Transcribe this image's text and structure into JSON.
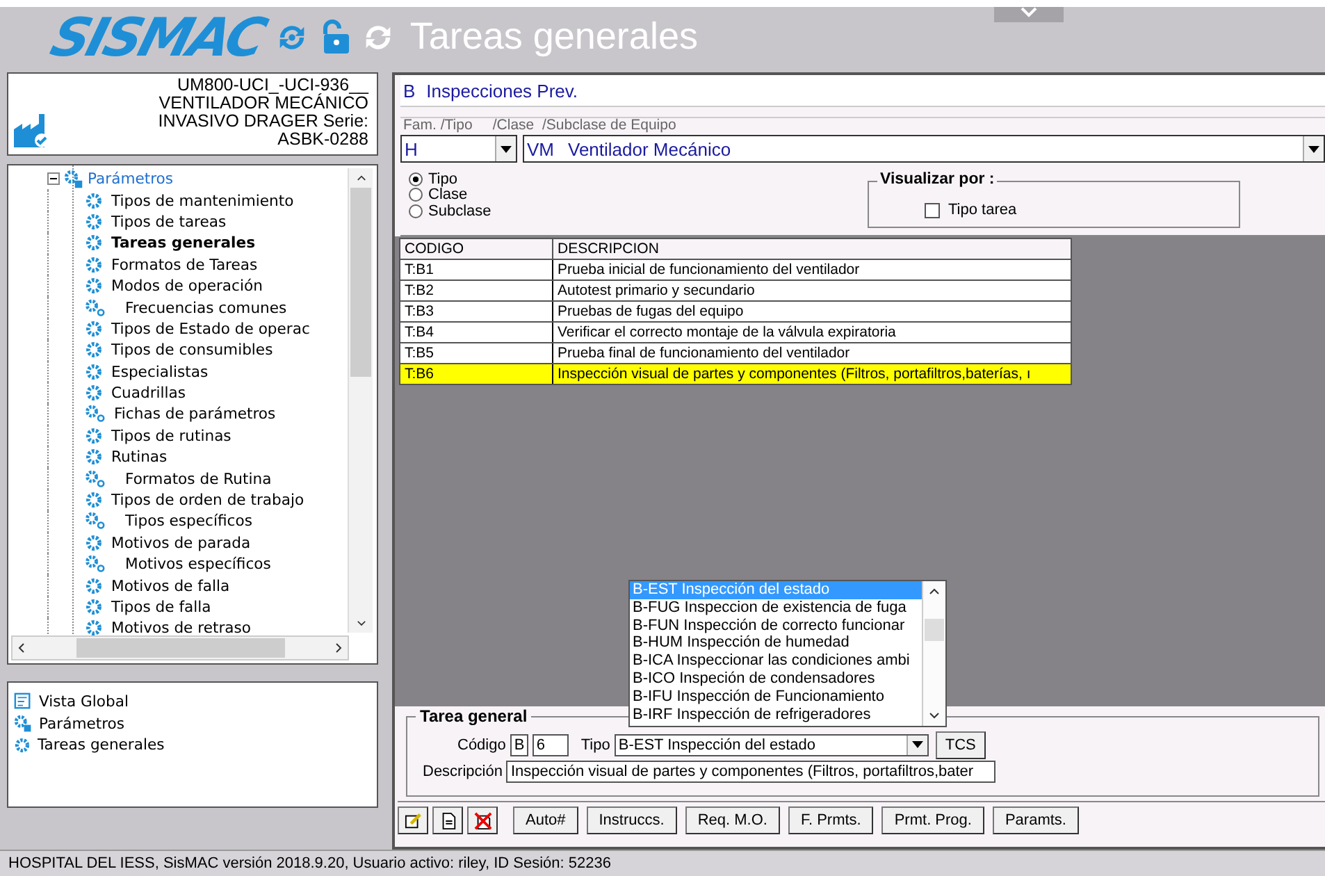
{
  "header": {
    "logo": "SISMAC",
    "title": "Tareas generales"
  },
  "equipment": {
    "lines": [
      "UM800-UCI_-UCI-936__",
      "VENTILADOR MECÁNICO",
      "INVASIVO DRAGER Serie:",
      "ASBK-0288"
    ]
  },
  "tree": {
    "root": {
      "label": "Parámetros",
      "expanded": true,
      "children": [
        {
          "label": "Tipos de mantenimiento",
          "kind": "item",
          "selected": false
        },
        {
          "label": "Tipos de tareas",
          "kind": "item",
          "selected": false
        },
        {
          "label": "Tareas generales",
          "kind": "item",
          "selected": true
        },
        {
          "label": "Formatos de Tareas",
          "kind": "item",
          "selected": false
        },
        {
          "label": "Modos de operación",
          "kind": "item",
          "selected": false
        },
        {
          "label": "Frecuencias comunes",
          "kind": "subgroup",
          "selected": false
        },
        {
          "label": "Tipos de Estado de operac",
          "kind": "item",
          "selected": false
        },
        {
          "label": "Tipos de consumibles",
          "kind": "item",
          "selected": false
        },
        {
          "label": "Especialistas",
          "kind": "item",
          "selected": false
        },
        {
          "label": "Cuadrillas",
          "kind": "item",
          "selected": false
        },
        {
          "label": "Fichas de parámetros",
          "kind": "group",
          "selected": false
        },
        {
          "label": "Tipos de rutinas",
          "kind": "item",
          "selected": false
        },
        {
          "label": "Rutinas",
          "kind": "item",
          "selected": false
        },
        {
          "label": "Formatos de Rutina",
          "kind": "subgroup",
          "selected": false
        },
        {
          "label": "Tipos de orden de trabajo",
          "kind": "item",
          "selected": false
        },
        {
          "label": "Tipos específicos",
          "kind": "subgroup",
          "selected": false
        },
        {
          "label": "Motivos de parada",
          "kind": "item",
          "selected": false
        },
        {
          "label": "Motivos específicos",
          "kind": "subgroup",
          "selected": false
        },
        {
          "label": "Motivos de falla",
          "kind": "item",
          "selected": false
        },
        {
          "label": "Tipos de falla",
          "kind": "item",
          "selected": false
        },
        {
          "label": "Motivos de retraso",
          "kind": "item",
          "selected": false
        }
      ]
    }
  },
  "breadcrumb": [
    {
      "label": "Vista Global",
      "kind": "global"
    },
    {
      "label": "Parámetros",
      "kind": "group"
    },
    {
      "label": "Tareas generales",
      "kind": "item"
    }
  ],
  "category": {
    "code": "B",
    "name": "Inspecciones Prev."
  },
  "equipment_filter": {
    "legend": "Fam. /Tipo     /Clase  /Subclase de Equipo",
    "family": "H",
    "type_code": "VM",
    "type_name": "Ventilador Mecánico"
  },
  "view_by": [
    {
      "label": "Tipo",
      "selected": true
    },
    {
      "label": "Clase",
      "selected": false
    },
    {
      "label": "Subclase",
      "selected": false
    }
  ],
  "visualizar": {
    "title": "Visualizar por :",
    "checkbox": {
      "label": "Tipo tarea",
      "checked": false
    }
  },
  "table": {
    "columns": [
      "CODIGO",
      "DESCRIPCION"
    ],
    "rows": [
      {
        "code": "T:B1",
        "description": "Prueba inicial de funcionamiento del ventilador",
        "selected": false
      },
      {
        "code": "T:B2",
        "description": "Autotest primario y secundario",
        "selected": false
      },
      {
        "code": "T:B3",
        "description": "Pruebas de fugas del equipo",
        "selected": false
      },
      {
        "code": "T:B4",
        "description": "Verificar el correcto montaje de la válvula expiratoria",
        "selected": false
      },
      {
        "code": "T:B5",
        "description": "Prueba final de funcionamiento del ventilador",
        "selected": false
      },
      {
        "code": "T:B6",
        "description": "Inspección visual de partes y componentes (Filtros, portafiltros,baterías, ı",
        "selected": true
      }
    ]
  },
  "dropdown": {
    "options": [
      {
        "label": "B-EST Inspección del estado",
        "selected": true
      },
      {
        "label": "B-FUG Inspeccion de existencia de fuga",
        "selected": false
      },
      {
        "label": "B-FUN Inspección de correcto funcionar",
        "selected": false
      },
      {
        "label": "B-HUM Inspección de humedad",
        "selected": false
      },
      {
        "label": "B-ICA Inspeccionar las condiciones ambi",
        "selected": false
      },
      {
        "label": "B-ICO Inspeción de condensadores",
        "selected": false
      },
      {
        "label": "B-IFU Inspección de Funcionamiento",
        "selected": false
      },
      {
        "label": "B-IRF Inspección de refrigeradores",
        "selected": false
      }
    ]
  },
  "form": {
    "title": "Tarea general",
    "code_label": "Código",
    "code_prefix": "B",
    "code_number": "6",
    "type_label": "Tipo",
    "type_value": "B-EST Inspección del estado",
    "tcs": "TCS",
    "description_label": "Descripción",
    "description": "Inspección visual de partes y componentes (Filtros, portafiltros,bater"
  },
  "actions": [
    {
      "kind": "edit"
    },
    {
      "kind": "new"
    },
    {
      "kind": "delete"
    },
    {
      "label": "Auto#",
      "kind": "text"
    },
    {
      "label": "Instruccs.",
      "kind": "text"
    },
    {
      "label": "Req. M.O.",
      "kind": "text"
    },
    {
      "label": "F. Prmts.",
      "kind": "text"
    },
    {
      "label": "Prmt. Prog.",
      "kind": "text"
    },
    {
      "label": "Paramts.",
      "kind": "text"
    }
  ],
  "status_bar": "HOSPITAL DEL IESS, SisMAC versión 2018.9.20, Usuario activo: riley, ID Sesión: 52236"
}
